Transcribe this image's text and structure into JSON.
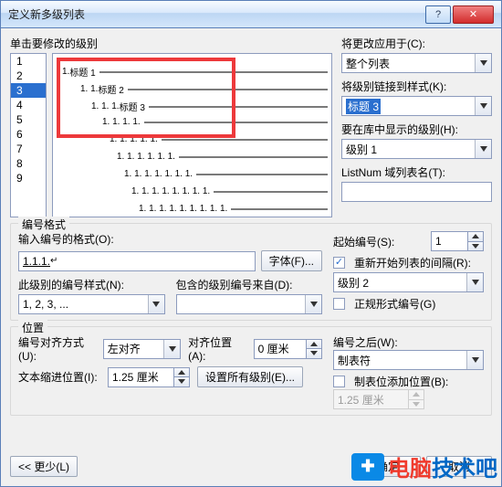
{
  "window": {
    "title": "定义新多级列表"
  },
  "labels": {
    "click_level": "单击要修改的级别",
    "apply_to": "将更改应用于(C):",
    "link_style": "将级别链接到样式(K):",
    "show_in_gallery": "要在库中显示的级别(H):",
    "listnum": "ListNum 域列表名(T):"
  },
  "apply_to_value": "整个列表",
  "link_style_value": "标题 3",
  "show_in_gallery_value": "级别 1",
  "listnum_value": "",
  "levels": [
    "1",
    "2",
    "3",
    "4",
    "5",
    "6",
    "7",
    "8",
    "9"
  ],
  "selected_level_index": 2,
  "preview_items": [
    {
      "num": "1.",
      "label": "标题 1",
      "indent": 6
    },
    {
      "num": "1. 1.",
      "label": "标题 2",
      "indent": 26
    },
    {
      "num": "1. 1. 1.",
      "label": "标题 3",
      "indent": 38
    },
    {
      "num": "1. 1. 1. 1.",
      "label": "",
      "indent": 50
    },
    {
      "num": "1. 1. 1. 1. 1.",
      "label": "",
      "indent": 58
    },
    {
      "num": "1. 1. 1. 1. 1. 1.",
      "label": "",
      "indent": 66
    },
    {
      "num": "1. 1. 1. 1. 1. 1. 1.",
      "label": "",
      "indent": 74
    },
    {
      "num": "1. 1. 1. 1. 1. 1. 1. 1.",
      "label": "",
      "indent": 82
    },
    {
      "num": "1. 1. 1. 1. 1. 1. 1. 1. 1.",
      "label": "",
      "indent": 90
    }
  ],
  "format": {
    "legend": "编号格式",
    "enter_format": "输入编号的格式(O):",
    "format_value": "1.1.1.",
    "font_btn": "字体(F)...",
    "style_label": "此级别的编号样式(N):",
    "style_value": "1, 2, 3, ...",
    "include_label": "包含的级别编号来自(D):",
    "include_value": "",
    "start_at": "起始编号(S):",
    "start_value": "1",
    "restart_label": "重新开始列表的间隔(R):",
    "restart_value": "级别 2",
    "legal_label": "正规形式编号(G)"
  },
  "position": {
    "legend": "位置",
    "align_label": "编号对齐方式(U):",
    "align_value": "左对齐",
    "align_at_label": "对齐位置(A):",
    "align_at_value": "0 厘米",
    "indent_label": "文本缩进位置(I):",
    "indent_value": "1.25 厘米",
    "set_all": "设置所有级别(E)...",
    "follow_label": "编号之后(W):",
    "follow_value": "制表符",
    "tab_add_label": "制表位添加位置(B):",
    "tab_value": "1.25 厘米"
  },
  "buttons": {
    "less": "<< 更少(L)",
    "ok": "确定",
    "cancel": "取消"
  },
  "watermark": {
    "a": "电脑",
    "b": "技术吧"
  }
}
